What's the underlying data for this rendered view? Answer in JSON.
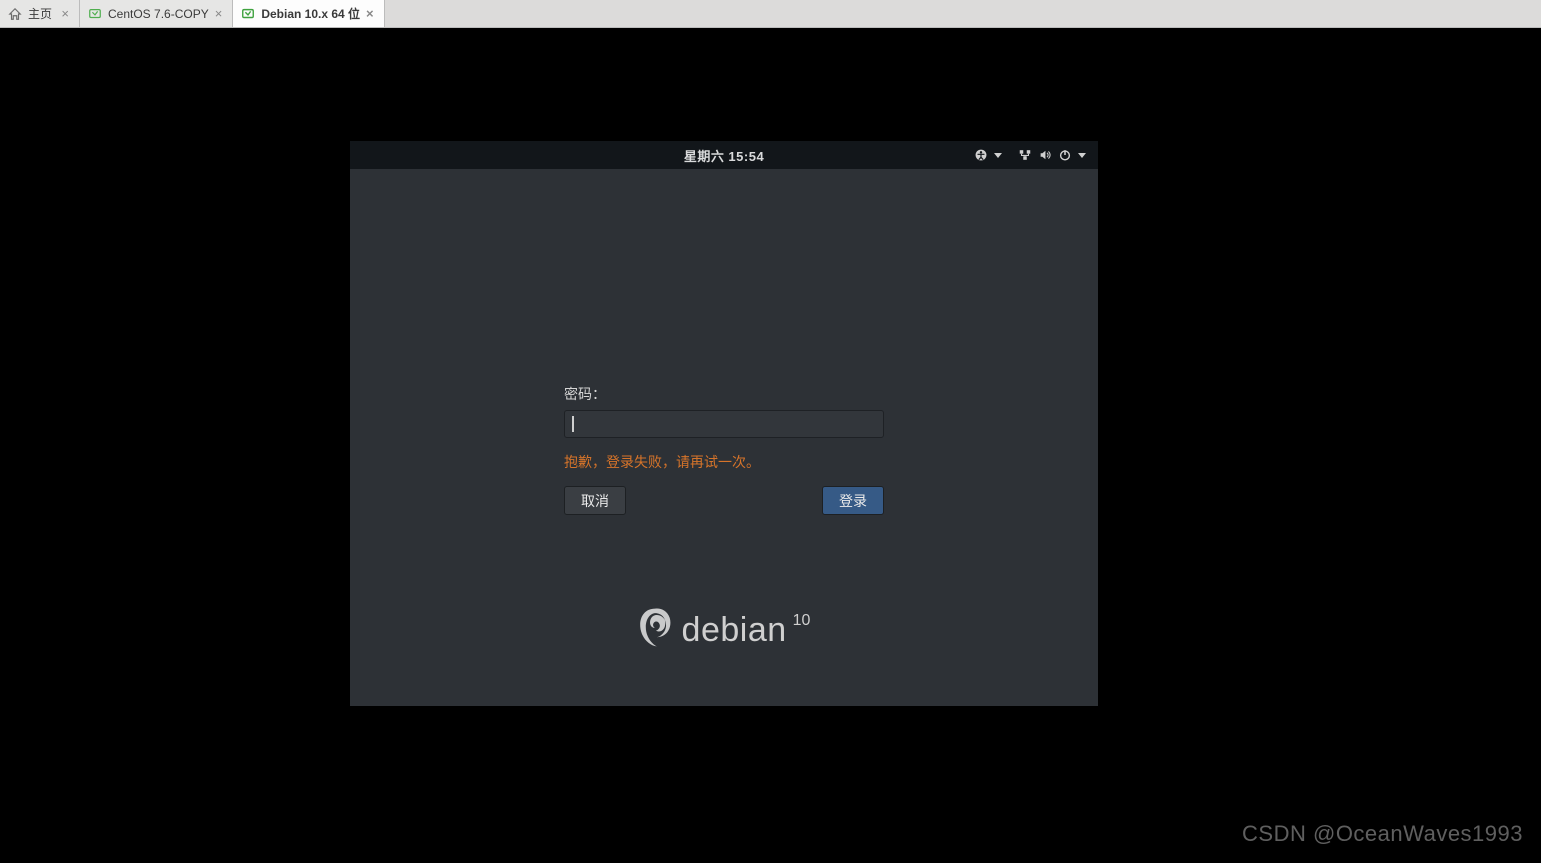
{
  "tabs": [
    {
      "label": "主页",
      "type": "home"
    },
    {
      "label": "CentOS 7.6-COPY",
      "type": "vm"
    },
    {
      "label": "Debian 10.x 64 位",
      "type": "vm",
      "active": true
    }
  ],
  "panel": {
    "clock": "星期六 15:54"
  },
  "login": {
    "password_label": "密码：",
    "password_value": "",
    "error_message": "抱歉，登录失败，请再试一次。",
    "cancel_label": "取消",
    "login_label": "登录"
  },
  "brand": {
    "name": "debian",
    "version": "10"
  },
  "watermark": "CSDN @OceanWaves1993"
}
